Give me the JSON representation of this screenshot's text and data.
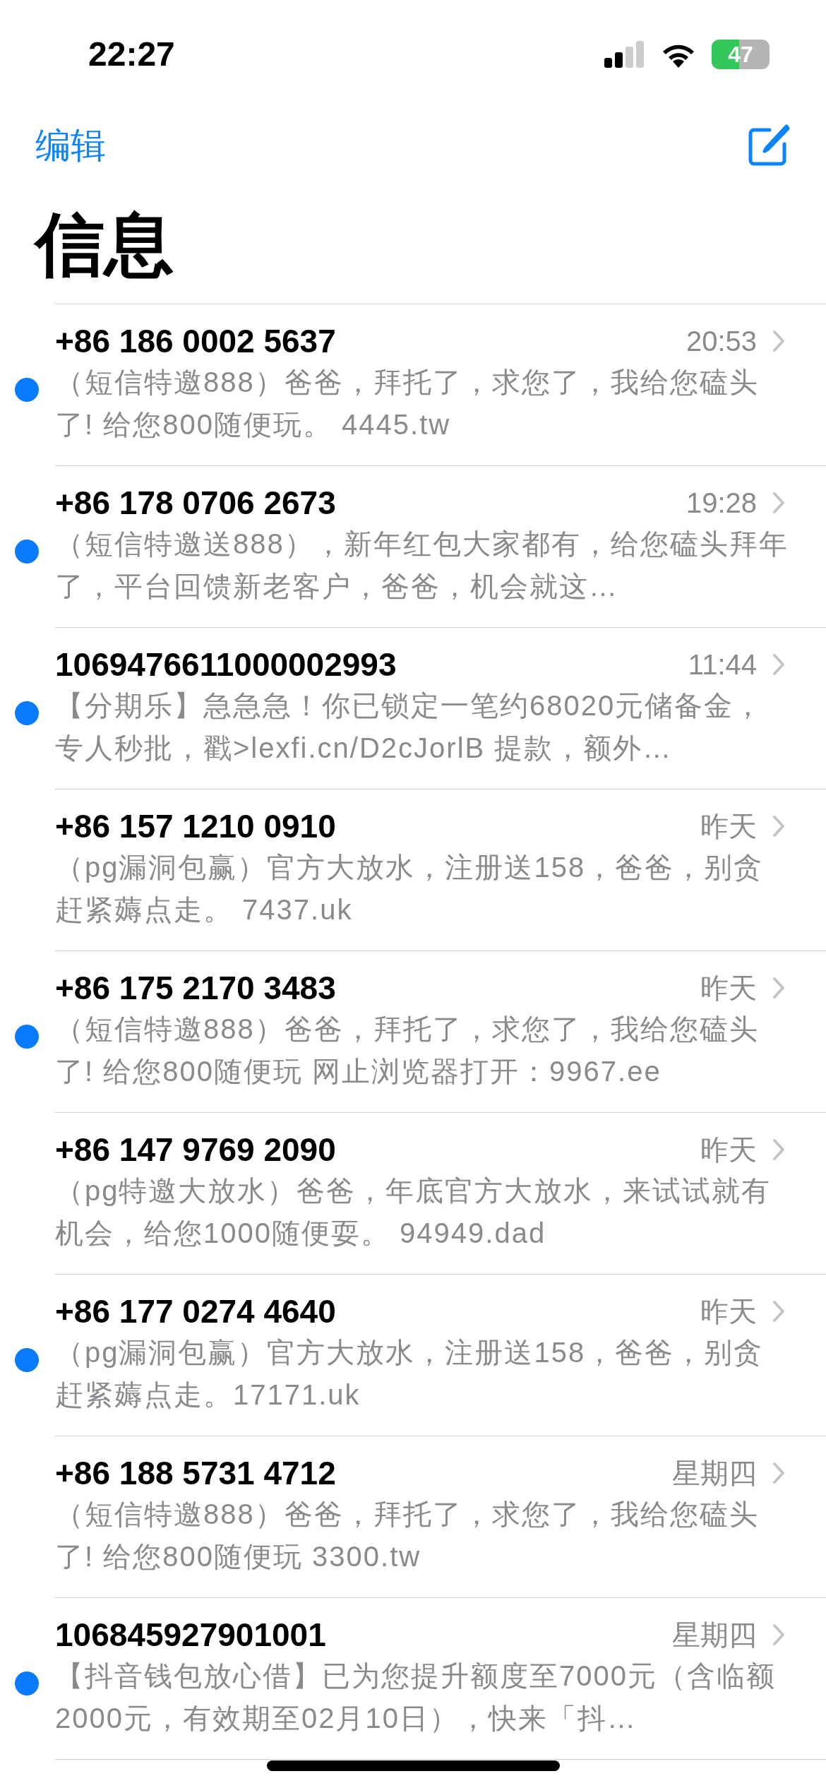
{
  "status_bar": {
    "time": "22:27",
    "battery": "47"
  },
  "nav": {
    "edit": "编辑"
  },
  "title": "信息",
  "messages": [
    {
      "sender": "+86 186 0002 5637",
      "time": "20:53",
      "unread": true,
      "preview": "（短信特邀888）爸爸，拜托了，求您了，我给您磕头了! 给您800随便玩。 4445.tw"
    },
    {
      "sender": "+86 178 0706 2673",
      "time": "19:28",
      "unread": true,
      "preview": "（短信特邀送888），新年红包大家都有，给您磕头拜年了，平台回馈新老客户，爸爸，机会就这…"
    },
    {
      "sender": "1069476611000002993",
      "time": "11:44",
      "unread": true,
      "preview": "【分期乐】急急急！你已锁定一笔约68020元储备金，专人秒批，戳>lexfi.cn/D2cJorlB 提款，额外…"
    },
    {
      "sender": "+86 157 1210 0910",
      "time": "昨天",
      "unread": false,
      "preview": "（pg漏洞包赢）官方大放水，注册送158，爸爸，别贪赶紧薅点走。 7437.uk"
    },
    {
      "sender": "+86 175 2170 3483",
      "time": "昨天",
      "unread": true,
      "preview": "（短信特邀888）爸爸，拜托了，求您了，我给您磕头了! 给您800随便玩 网止浏览器打开：9967.ee"
    },
    {
      "sender": "+86 147 9769 2090",
      "time": "昨天",
      "unread": false,
      "preview": "（pg特邀大放水）爸爸，年底官方大放水，来试试就有机会，给您1000随便耍。 94949.dad"
    },
    {
      "sender": "+86 177 0274 4640",
      "time": "昨天",
      "unread": true,
      "preview": "（pg漏洞包赢）官方大放水，注册送158，爸爸，别贪赶紧薅点走。17171.uk"
    },
    {
      "sender": "+86 188 5731 4712",
      "time": "星期四",
      "unread": false,
      "preview": "（短信特邀888）爸爸，拜托了，求您了，我给您磕头了! 给您800随便玩  3300.tw"
    },
    {
      "sender": "106845927901001",
      "time": "星期四",
      "unread": true,
      "preview": "【抖音钱包放心借】已为您提升额度至7000元（含临额2000元，有效期至02月10日），快来「抖…"
    }
  ]
}
